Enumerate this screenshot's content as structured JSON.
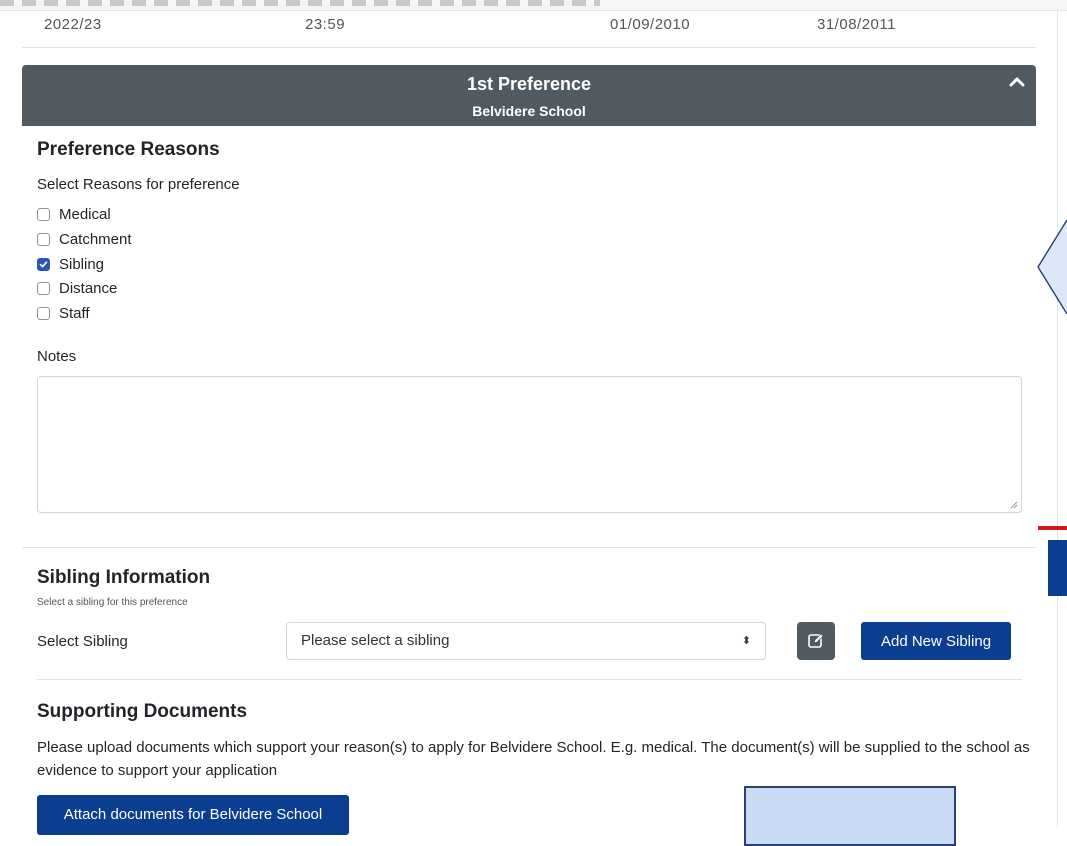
{
  "table_row": {
    "year": "2022/23",
    "time": "23:59",
    "date_from": "01/09/2010",
    "date_to": "31/08/2011"
  },
  "preference": {
    "title": "1st Preference",
    "school": "Belvidere School"
  },
  "reasons": {
    "heading": "Preference Reasons",
    "instruction": "Select Reasons for preference",
    "options": [
      {
        "label": "Medical",
        "checked": false
      },
      {
        "label": "Catchment",
        "checked": false
      },
      {
        "label": "Sibling",
        "checked": true
      },
      {
        "label": "Distance",
        "checked": false
      },
      {
        "label": "Staff",
        "checked": false
      }
    ],
    "notes_label": "Notes",
    "notes_value": ""
  },
  "sibling": {
    "heading": "Sibling Information",
    "subtext": "Select a sibling for this preference",
    "select_label": "Select Sibling",
    "select_value": "Please select a sibling",
    "add_button": "Add New Sibling"
  },
  "documents": {
    "heading": "Supporting Documents",
    "description": "Please upload documents which support your reason(s) to apply for Belvidere School. E.g. medical. The document(s) will be supplied to the school as evidence to support your application",
    "attach_button": "Attach documents for Belvidere School"
  },
  "icons": {
    "collapse": "chevron-up-icon",
    "edit": "edit-icon",
    "select_arrows": "sort-arrows-icon"
  },
  "colors": {
    "header_bg": "#515a61",
    "primary": "#0b3d91",
    "checkbox_checked": "#2b56b8"
  }
}
